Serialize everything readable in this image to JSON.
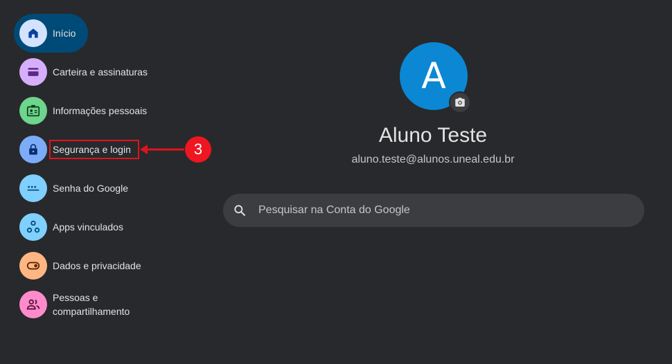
{
  "sidebar": {
    "items": [
      {
        "label": "Início",
        "icon": "home-icon",
        "color": "#d3e3fd",
        "active": true
      },
      {
        "label": "Carteira e assinaturas",
        "icon": "wallet-icon",
        "color": "#d7aefb"
      },
      {
        "label": "Informações pessoais",
        "icon": "id-card-icon",
        "color": "#6dd58c"
      },
      {
        "label": "Segurança e login",
        "icon": "lock-icon",
        "color": "#7cacf8"
      },
      {
        "label": "Senha do Google",
        "icon": "password-icon",
        "color": "#7fcfff"
      },
      {
        "label": "Apps vinculados",
        "icon": "connected-apps-icon",
        "color": "#7fcfff"
      },
      {
        "label": "Dados e privacidade",
        "icon": "toggle-icon",
        "color": "#ffb683"
      },
      {
        "label": "Pessoas e compartilhamento",
        "icon": "people-icon",
        "color": "#ff8bcb"
      }
    ]
  },
  "annotation": {
    "step": "3",
    "color": "#e0141c"
  },
  "profile": {
    "avatar_letter": "A",
    "avatar_color": "#0b87d4",
    "name": "Aluno Teste",
    "email": "aluno.teste@alunos.uneal.edu.br"
  },
  "search": {
    "placeholder": "Pesquisar na Conta do Google"
  }
}
